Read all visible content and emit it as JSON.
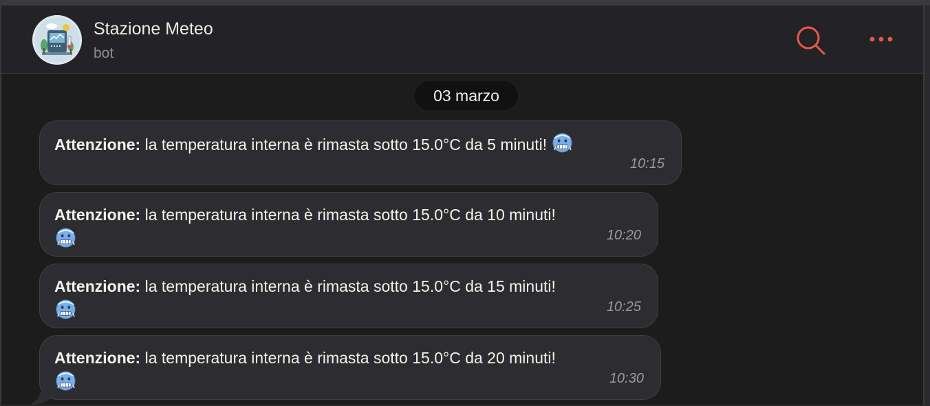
{
  "header": {
    "title": "Stazione Meteo",
    "subtitle": "bot"
  },
  "date_separator": "03 marzo",
  "messages": [
    {
      "bold": "Attenzione:",
      "text": " la temperatura interna è rimasta sotto 15.0°C da 5 minuti! ",
      "emoji": "cold-face-emoji",
      "time": "10:15"
    },
    {
      "bold": "Attenzione:",
      "text": " la temperatura interna è rimasta sotto 15.0°C da 10 minuti!",
      "emoji": "cold-face-emoji",
      "time": "10:20"
    },
    {
      "bold": "Attenzione:",
      "text": " la temperatura interna è rimasta sotto 15.0°C da 15 minuti!",
      "emoji": "cold-face-emoji",
      "time": "10:25"
    },
    {
      "bold": "Attenzione:",
      "text": " la temperatura interna è rimasta sotto 15.0°C da 20 minuti!",
      "emoji": "cold-face-emoji",
      "time": "10:30"
    }
  ],
  "icons": {
    "search": "search-icon",
    "more": "more-options-icon",
    "avatar": "weather-station-avatar"
  },
  "colors": {
    "accent": "#e5584f",
    "background": "#1c1c1d",
    "bubble": "#2d2d2f"
  }
}
